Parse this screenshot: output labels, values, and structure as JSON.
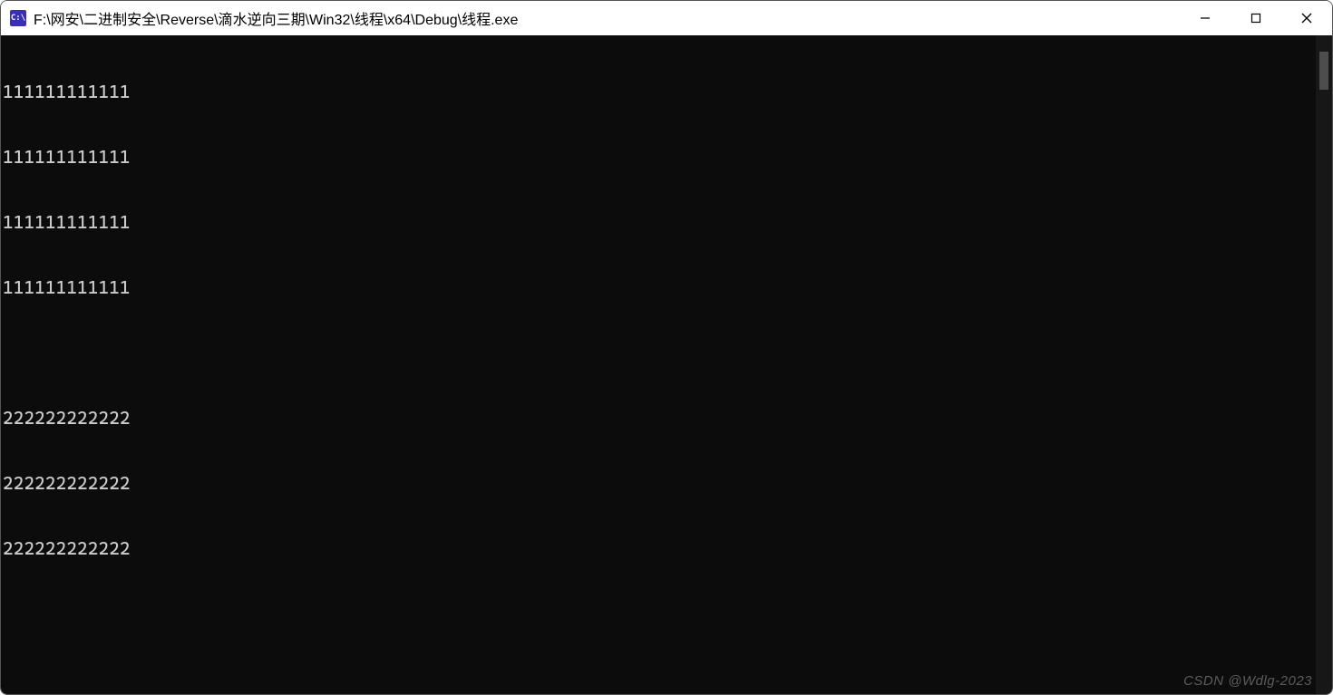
{
  "titlebar": {
    "icon_label": "C:\\",
    "title": "F:\\网安\\二进制安全\\Reverse\\滴水逆向三期\\Win32\\线程\\x64\\Debug\\线程.exe"
  },
  "window_controls": {
    "minimize": "minimize",
    "maximize": "maximize",
    "close": "close"
  },
  "console": {
    "lines": [
      "111111111111",
      "111111111111",
      "111111111111",
      "111111111111",
      "",
      "222222222222",
      "222222222222",
      "222222222222"
    ]
  },
  "watermark": "CSDN @Wdlg-2023"
}
